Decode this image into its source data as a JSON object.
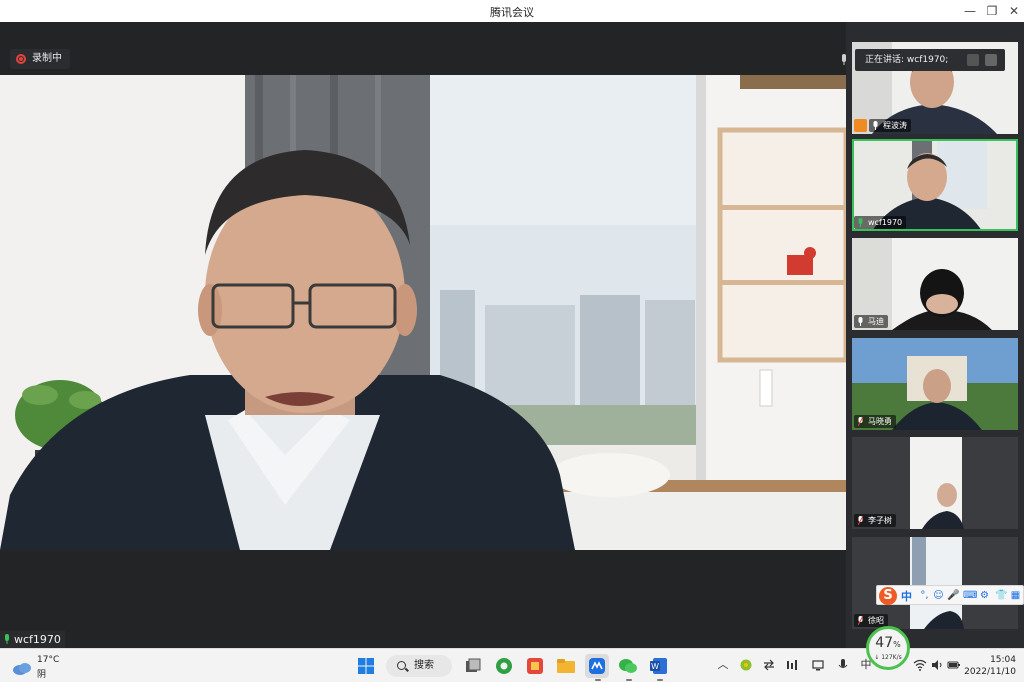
{
  "window": {
    "title": "腾讯会议",
    "minimize": "—",
    "restore": "❐",
    "close": "✕"
  },
  "recording": {
    "label": "录制中"
  },
  "speaking": {
    "text": "正在讲话: wcf1970;"
  },
  "main_video": {
    "name": "wcf1970"
  },
  "participants": [
    {
      "name": "程波涛",
      "host": true
    },
    {
      "name": "wcf1970",
      "active": true
    },
    {
      "name": "马迪"
    },
    {
      "name": "马晓勇"
    },
    {
      "name": "李子树"
    },
    {
      "name": "徐昭"
    }
  ],
  "ime": {
    "logo": "S",
    "lang": "中",
    "icons": [
      "°,",
      "☺",
      "🎤",
      "⌨",
      "⚙",
      "👕",
      "▦"
    ]
  },
  "network": {
    "percent": "47",
    "percent_unit": "%",
    "speed": "↓ 127K/s"
  },
  "taskbar": {
    "weather": {
      "temp": "17°C",
      "cond": "阴"
    },
    "search_label": "搜索",
    "clock": {
      "time": "15:04",
      "date": "2022/11/10"
    },
    "ime_indicator": "中",
    "tray_overflow": "︿"
  },
  "colors": {
    "accent_green": "#38c05a",
    "record_red": "#e2443a",
    "host_orange": "#f08a22",
    "ime_orange": "#ef5b24"
  }
}
